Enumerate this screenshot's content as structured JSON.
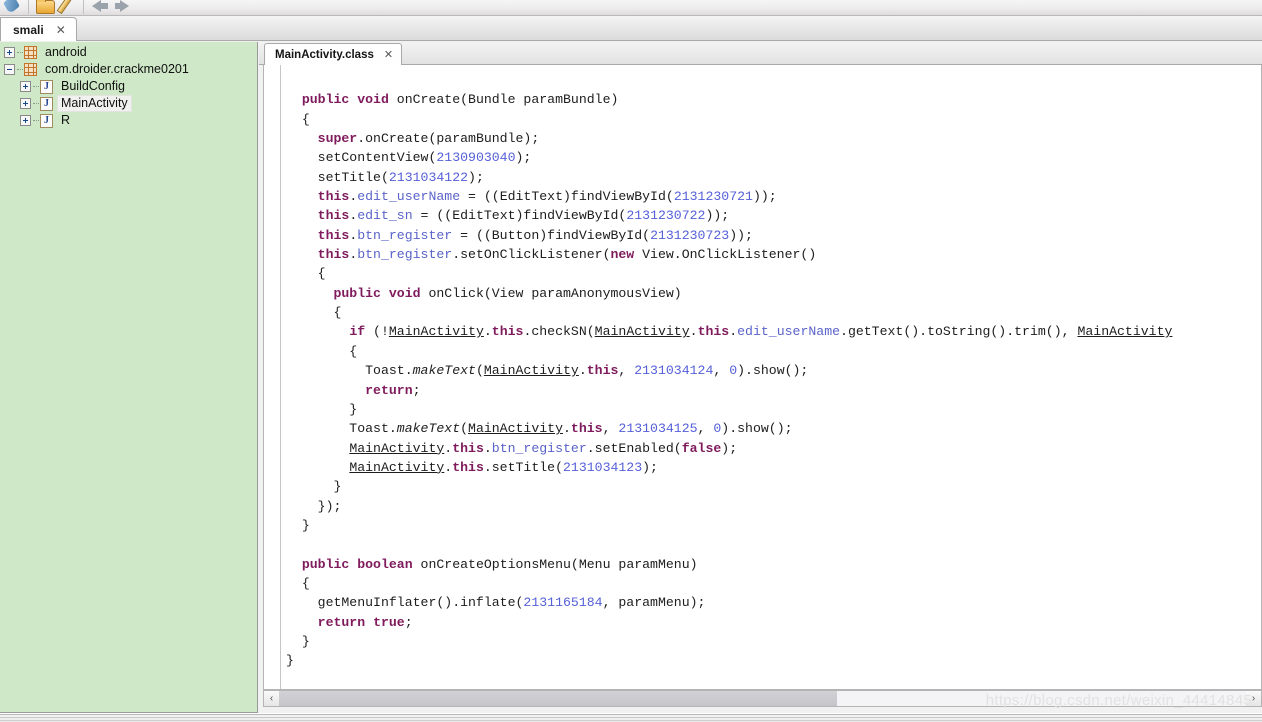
{
  "toolbar": {
    "icons": [
      "wrench-icon",
      "folder-open-icon",
      "pen-icon",
      "back-arrow-icon",
      "forward-arrow-icon"
    ]
  },
  "top_tab": {
    "label": "smali",
    "close": "✕"
  },
  "sidebar": {
    "tree": [
      {
        "label": "android",
        "level": 0,
        "icon": "package-icon",
        "toggle": "plus",
        "selected": false
      },
      {
        "label": "com.droider.crackme0201",
        "level": 0,
        "icon": "package-icon",
        "toggle": "minus",
        "selected": false
      },
      {
        "label": "BuildConfig",
        "level": 1,
        "icon": "java-class-icon",
        "toggle": "plus",
        "selected": false
      },
      {
        "label": "MainActivity",
        "level": 1,
        "icon": "java-class-icon",
        "toggle": "plus",
        "selected": true
      },
      {
        "label": "R",
        "level": 1,
        "icon": "java-class-icon",
        "toggle": "plus",
        "selected": false
      }
    ]
  },
  "editor": {
    "tab": {
      "label": "MainActivity.class",
      "close": "✕"
    },
    "scrollbar": {
      "left_arrow": "‹",
      "right_arrow": "›"
    },
    "code_lines": [
      "",
      "  public void onCreate(Bundle paramBundle)",
      "  {",
      "    super.onCreate(paramBundle);",
      "    setContentView(2130903040);",
      "    setTitle(2131034122);",
      "    this.edit_userName = ((EditText)findViewById(2131230721));",
      "    this.edit_sn = ((EditText)findViewById(2131230722));",
      "    this.btn_register = ((Button)findViewById(2131230723));",
      "    this.btn_register.setOnClickListener(new View.OnClickListener()",
      "    {",
      "      public void onClick(View paramAnonymousView)",
      "      {",
      "        if (!MainActivity.this.checkSN(MainActivity.this.edit_userName.getText().toString().trim(), MainActivity",
      "        {",
      "          Toast.makeText(MainActivity.this, 2131034124, 0).show();",
      "          return;",
      "        }",
      "        Toast.makeText(MainActivity.this, 2131034125, 0).show();",
      "        MainActivity.this.btn_register.setEnabled(false);",
      "        MainActivity.this.setTitle(2131034123);",
      "      }",
      "    });",
      "  }",
      "",
      "  public boolean onCreateOptionsMenu(Menu paramMenu)",
      "  {",
      "    getMenuInflater().inflate(2131165184, paramMenu);",
      "    return true;",
      "  }",
      "}"
    ]
  },
  "watermark": {
    "text": "https://blog.csdn.net/weixin_44414845"
  },
  "colors": {
    "sidebar_background": "#cfe8c7",
    "keyword": "#7f1b5c",
    "number": "#5560d8",
    "field": "#5a63c9",
    "editor_background": "#ffffff"
  }
}
